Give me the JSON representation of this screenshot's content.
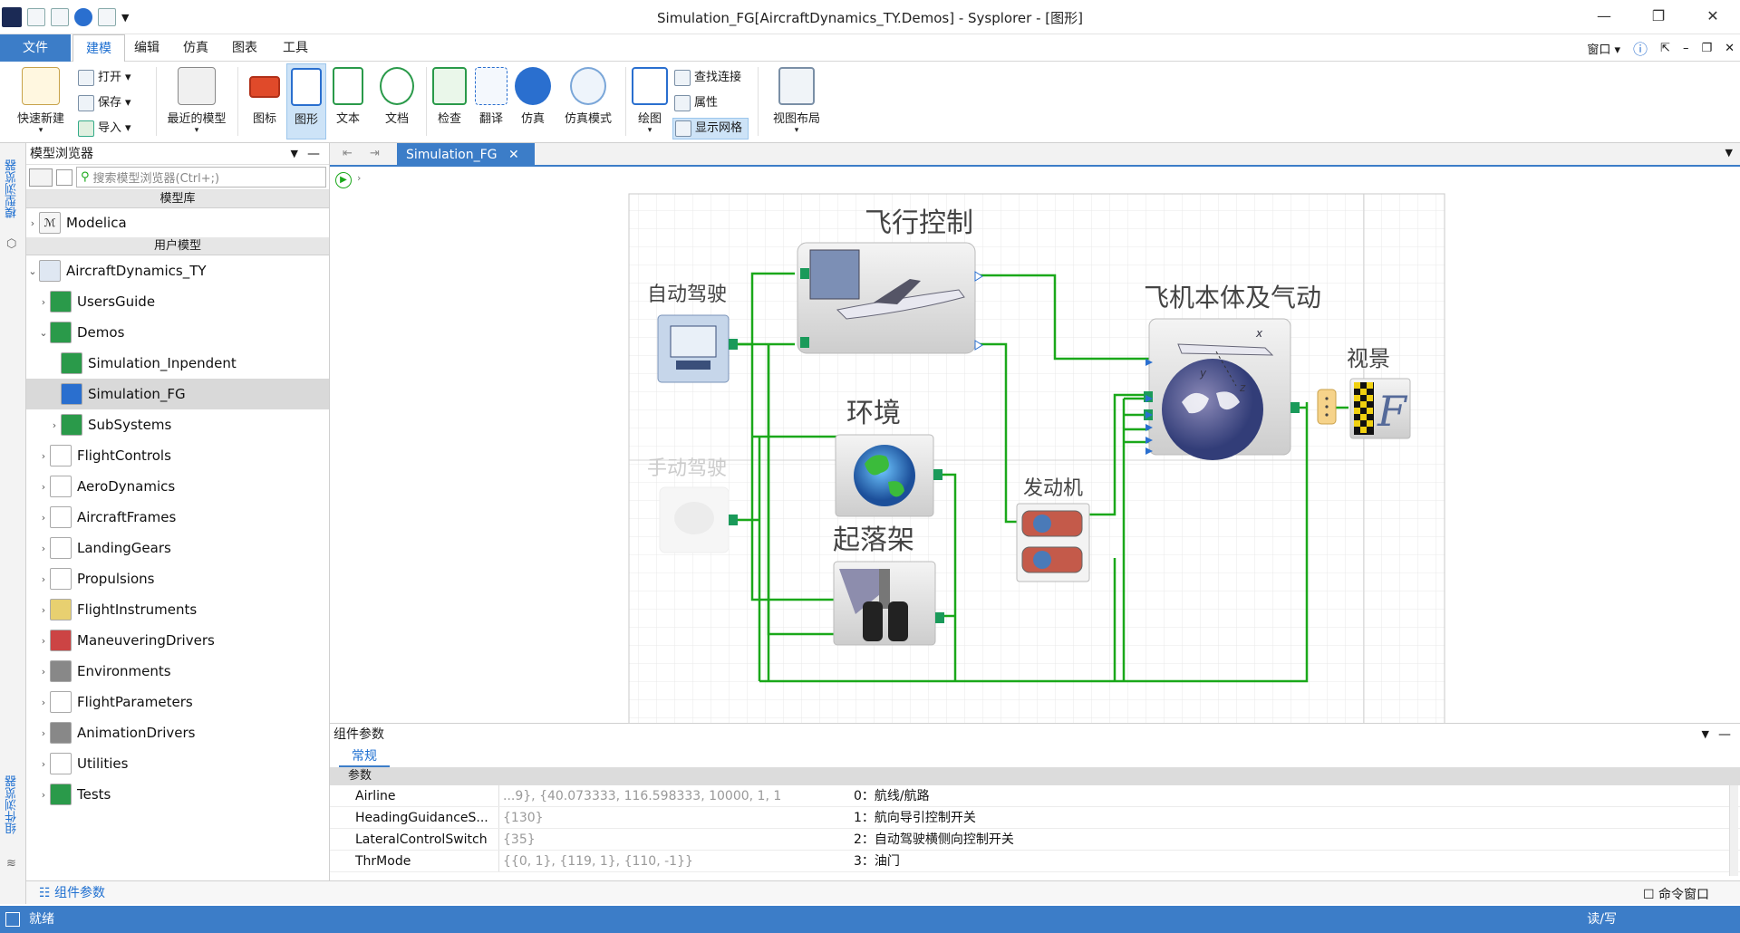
{
  "window": {
    "title": "Simulation_FG[AircraftDynamics_TY.Demos] - Sysplorer - [图形]"
  },
  "menu": {
    "file": "文件",
    "tabs": [
      "建模",
      "编辑",
      "仿真",
      "图表",
      "工具"
    ],
    "window_label": "窗口"
  },
  "ribbon": {
    "quick_new": "快速新建",
    "open": "打开",
    "save": "保存",
    "import": "导入",
    "recent": "最近的模型",
    "icon": "图标",
    "diagram": "图形",
    "text": "文本",
    "doc": "文档",
    "check": "检查",
    "translate": "翻译",
    "simulate": "仿真",
    "sim_mode": "仿真模式",
    "draw": "绘图",
    "find_conn": "查找连接",
    "props": "属性",
    "show_grid": "显示网格",
    "view_layout": "视图布局"
  },
  "browser": {
    "title": "模型浏览器",
    "search_placeholder": "搜索模型浏览器(Ctrl+;)",
    "lib_header": "模型库",
    "user_header": "用户模型",
    "modelica": "Modelica",
    "tree": [
      {
        "label": "AircraftDynamics_TY",
        "level": 0,
        "arrow": "⌄"
      },
      {
        "label": "UsersGuide",
        "level": 1,
        "arrow": "›"
      },
      {
        "label": "Demos",
        "level": 1,
        "arrow": "⌄"
      },
      {
        "label": "Simulation_Inpendent",
        "level": 2,
        "arrow": ""
      },
      {
        "label": "Simulation_FG",
        "level": 2,
        "arrow": ""
      },
      {
        "label": "SubSystems",
        "level": 2,
        "arrow": "›"
      },
      {
        "label": "FlightControls",
        "level": 1,
        "arrow": "›"
      },
      {
        "label": "AeroDynamics",
        "level": 1,
        "arrow": "›"
      },
      {
        "label": "AircraftFrames",
        "level": 1,
        "arrow": "›"
      },
      {
        "label": "LandingGears",
        "level": 1,
        "arrow": "›"
      },
      {
        "label": "Propulsions",
        "level": 1,
        "arrow": "›"
      },
      {
        "label": "FlightInstruments",
        "level": 1,
        "arrow": "›"
      },
      {
        "label": "ManeuveringDrivers",
        "level": 1,
        "arrow": "›"
      },
      {
        "label": "Environments",
        "level": 1,
        "arrow": "›"
      },
      {
        "label": "FlightParameters",
        "level": 1,
        "arrow": "›"
      },
      {
        "label": "AnimationDrivers",
        "level": 1,
        "arrow": "›"
      },
      {
        "label": "Utilities",
        "level": 1,
        "arrow": "›"
      },
      {
        "label": "Tests",
        "level": 1,
        "arrow": "›"
      }
    ],
    "footer": "组件参数"
  },
  "side_tabs": {
    "top": "模型浏览器",
    "bottom": "组件浏览器"
  },
  "doc_tab": {
    "label": "Simulation_FG"
  },
  "diagram": {
    "flight_control": "飞行控制",
    "autopilot": "自动驾驶",
    "manual": "手动驾驶",
    "environment": "环境",
    "engine": "发动机",
    "gear": "起落架",
    "body": "飞机本体及气动",
    "view": "视景"
  },
  "params": {
    "title": "组件参数",
    "tab": "常规",
    "group": "参数",
    "rows": [
      {
        "name": "Airline",
        "value": "...9}, {40.073333, 116.598333, 10000, 1, 1}}",
        "desc": "0：航线/航路"
      },
      {
        "name": "HeadingGuidanceS...",
        "value": "{130}",
        "desc": "1：航向导引控制开关"
      },
      {
        "name": "LateralControlSwitch",
        "value": "{35}",
        "desc": "2：自动驾驶横侧向控制开关"
      },
      {
        "name": "ThrMode",
        "value": "{{0, 1}, {119, 1}, {110, -1}}",
        "desc": "3：油门"
      }
    ]
  },
  "bottom": {
    "cmd_window": "命令窗口"
  },
  "status": {
    "left": "就绪",
    "right": "读/写"
  },
  "colors": {
    "accent": "#3c7dc8",
    "wire": "#1aa81a"
  }
}
